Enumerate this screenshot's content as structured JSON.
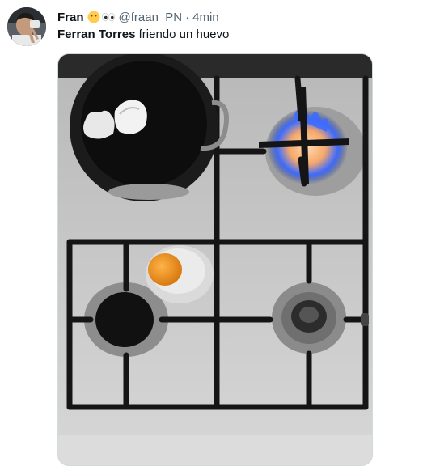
{
  "tweet": {
    "author_name": "Fran",
    "emoji_1": "neutral-face-emoji",
    "emoji_2": "eyes-emoji",
    "handle": "@fraan_PN",
    "separator": "·",
    "timestamp": "4min",
    "text_bold": "Ferran Torres",
    "text_rest": " friendo un huevo"
  },
  "media": {
    "description_icon": "stove-photo"
  },
  "colors": {
    "text_primary": "#0f1419",
    "text_secondary": "#536471",
    "border": "#cfd9de",
    "flame": "#3d6bff"
  }
}
